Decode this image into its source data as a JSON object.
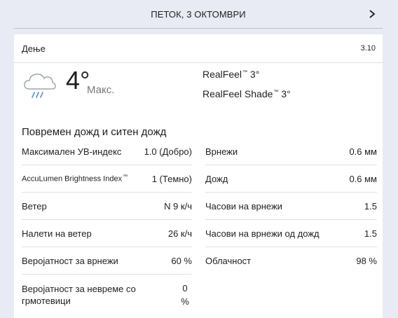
{
  "header": {
    "date_title": "ПЕТОК, 3 ОКТОМВРИ"
  },
  "card": {
    "period": "Дење",
    "date": "3.10",
    "temperature": "4°",
    "temp_label": "Макс.",
    "realfeel_label": "RealFeel",
    "realfeel_value": "3°",
    "realfeel_shade_label": "RealFeel Shade",
    "realfeel_shade_value": "3°",
    "trademark": "™",
    "icon": "cloud-rain-icon",
    "phrase": "Повремен дожд и ситен дожд"
  },
  "details_left": [
    {
      "label": "Максимален УВ-индекс",
      "value": "1.0 (Добро)"
    },
    {
      "label": "AccuLumen Brightness Index",
      "value": "1 (Темно)"
    },
    {
      "label": "Ветер",
      "value": "N 9 к/ч"
    },
    {
      "label": "Налети на ветер",
      "value": "26 к/ч"
    },
    {
      "label": "Веројатност за врнежи",
      "value": "60 %"
    },
    {
      "label": "Веројатност за невреме со грмотевици",
      "value_line1": "0",
      "value_line2": "%"
    }
  ],
  "details_right": [
    {
      "label": "Врнежи",
      "value": "0.6 мм"
    },
    {
      "label": "Дожд",
      "value": "0.6 мм"
    },
    {
      "label": "Часови на врнежи",
      "value": "1.5"
    },
    {
      "label": "Часови на врнежи од дожд",
      "value": "1.5"
    },
    {
      "label": "Облачност",
      "value": "98 %"
    }
  ]
}
